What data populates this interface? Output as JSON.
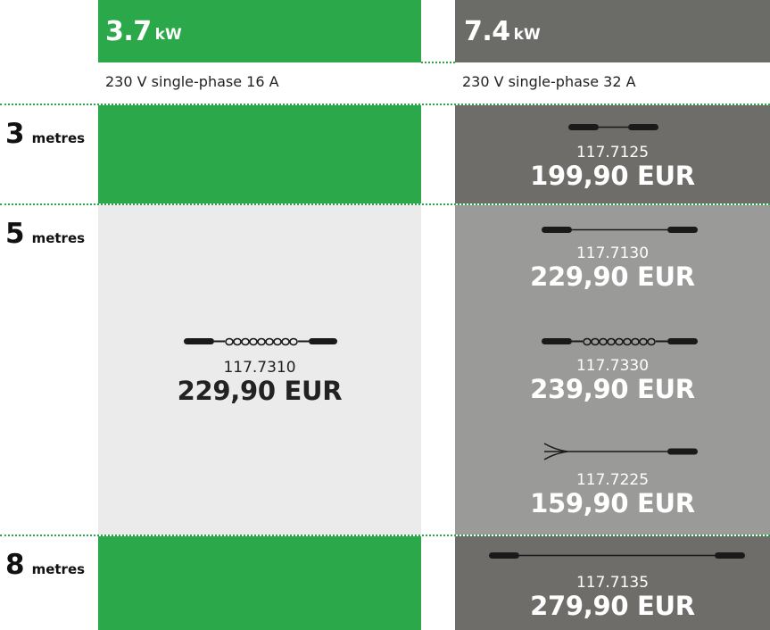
{
  "columns": [
    {
      "power_value": "3.7",
      "power_unit": "kW",
      "spec": "230 V single-phase 16 A"
    },
    {
      "power_value": "7.4",
      "power_unit": "kW",
      "spec": "230 V single-phase 32 A"
    }
  ],
  "rows": [
    {
      "number": "3",
      "unit": "metres"
    },
    {
      "number": "5",
      "unit": "metres"
    },
    {
      "number": "8",
      "unit": "metres"
    }
  ],
  "products": {
    "p7125": {
      "code": "117.7125",
      "price": "199,90 EUR",
      "cable_icon": "straight-cable-short"
    },
    "p7130": {
      "code": "117.7130",
      "price": "229,90 EUR",
      "cable_icon": "straight-cable"
    },
    "p7310": {
      "code": "117.7310",
      "price": "229,90 EUR",
      "cable_icon": "coiled-cable"
    },
    "p7330": {
      "code": "117.7330",
      "price": "239,90 EUR",
      "cable_icon": "coiled-cable"
    },
    "p7225": {
      "code": "117.7225",
      "price": "159,90 EUR",
      "cable_icon": "open-end-cable"
    },
    "p7135": {
      "code": "117.7135",
      "price": "279,90 EUR",
      "cable_icon": "straight-cable-long"
    }
  },
  "colors": {
    "green": "#2aa84a",
    "dark_grey": "#6e6d6a",
    "mid_grey": "#9a9a99",
    "light_grey": "#ebebeb"
  }
}
